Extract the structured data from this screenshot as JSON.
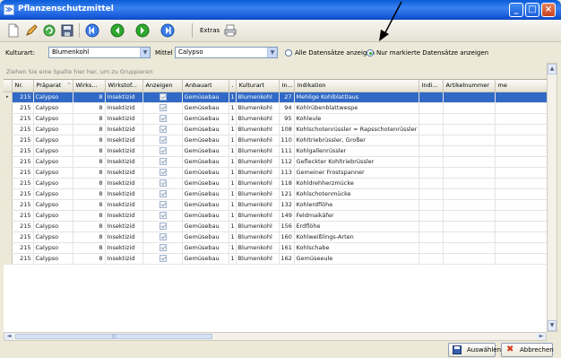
{
  "window": {
    "title": "Pflanzenschutzmittel"
  },
  "toolbar": {
    "extras_label": "Extras"
  },
  "filters": {
    "kulturart_label": "Kulturart:",
    "kulturart_value": "Blumenkohl",
    "mittel_label": "Mittel",
    "mittel_value": "Calypso",
    "radio_all_label": "Alle Datensätze anzeigen",
    "radio_marked_label": "Nur markierte Datensätze anzeigen",
    "selected_radio": "marked"
  },
  "grid": {
    "group_hint": "Ziehen Sie eine Spalte hier her, um zu Gruppieren",
    "columns": [
      "Nr.",
      "Präparat",
      "Wirks...",
      "Wirkstof...",
      "Anzeigen",
      "Anbauart",
      ".",
      "Kulturart",
      "In...",
      "Indikation",
      "Indi...",
      "Artikelnummer",
      "me"
    ],
    "sort_indicator": "^",
    "rows": [
      {
        "nr": "215",
        "praeparat": "Calypso",
        "wirks": "8",
        "wirkstof": "Insektizid",
        "anbauart": "Gemüsebau",
        "dot": "1",
        "kulturart": "Blumenkohl",
        "in": "27",
        "indikation": "Mehlige Kohlblattlaus",
        "selected": true
      },
      {
        "nr": "215",
        "praeparat": "Calypso",
        "wirks": "8",
        "wirkstof": "Insektizid",
        "anbauart": "Gemüsebau",
        "dot": "1",
        "kulturart": "Blumenkohl",
        "in": "94",
        "indikation": "Kohlrübenblattwespe"
      },
      {
        "nr": "215",
        "praeparat": "Calypso",
        "wirks": "8",
        "wirkstof": "Insektizid",
        "anbauart": "Gemüsebau",
        "dot": "1",
        "kulturart": "Blumenkohl",
        "in": "95",
        "indikation": "Kohleule"
      },
      {
        "nr": "215",
        "praeparat": "Calypso",
        "wirks": "8",
        "wirkstof": "Insektizid",
        "anbauart": "Gemüsebau",
        "dot": "1",
        "kulturart": "Blumenkohl",
        "in": "108",
        "indikation": "Kohlschotenrüssler = Rapsschotenrüssler"
      },
      {
        "nr": "215",
        "praeparat": "Calypso",
        "wirks": "8",
        "wirkstof": "Insektizid",
        "anbauart": "Gemüsebau",
        "dot": "1",
        "kulturart": "Blumenkohl",
        "in": "110",
        "indikation": "Kohltriebrüssler, Großer"
      },
      {
        "nr": "215",
        "praeparat": "Calypso",
        "wirks": "8",
        "wirkstof": "Insektizid",
        "anbauart": "Gemüsebau",
        "dot": "1",
        "kulturart": "Blumenkohl",
        "in": "111",
        "indikation": "Kohlgallenrüssler"
      },
      {
        "nr": "215",
        "praeparat": "Calypso",
        "wirks": "8",
        "wirkstof": "Insektizid",
        "anbauart": "Gemüsebau",
        "dot": "1",
        "kulturart": "Blumenkohl",
        "in": "112",
        "indikation": "Gefleckter Kohltriebrüssler"
      },
      {
        "nr": "215",
        "praeparat": "Calypso",
        "wirks": "8",
        "wirkstof": "Insektizid",
        "anbauart": "Gemüsebau",
        "dot": "1",
        "kulturart": "Blumenkohl",
        "in": "113",
        "indikation": "Gemeiner Frostspanner"
      },
      {
        "nr": "215",
        "praeparat": "Calypso",
        "wirks": "8",
        "wirkstof": "Insektizid",
        "anbauart": "Gemüsebau",
        "dot": "1",
        "kulturart": "Blumenkohl",
        "in": "118",
        "indikation": "Kohldrehherzmücke"
      },
      {
        "nr": "215",
        "praeparat": "Calypso",
        "wirks": "8",
        "wirkstof": "Insektizid",
        "anbauart": "Gemüsebau",
        "dot": "1",
        "kulturart": "Blumenkohl",
        "in": "121",
        "indikation": "Kohlschotenmücke"
      },
      {
        "nr": "215",
        "praeparat": "Calypso",
        "wirks": "8",
        "wirkstof": "Insektizid",
        "anbauart": "Gemüsebau",
        "dot": "1",
        "kulturart": "Blumenkohl",
        "in": "132",
        "indikation": "Kohlerdflöhe"
      },
      {
        "nr": "215",
        "praeparat": "Calypso",
        "wirks": "8",
        "wirkstof": "Insektizid",
        "anbauart": "Gemüsebau",
        "dot": "1",
        "kulturart": "Blumenkohl",
        "in": "149",
        "indikation": "Feldmaikäfer"
      },
      {
        "nr": "215",
        "praeparat": "Calypso",
        "wirks": "8",
        "wirkstof": "Insektizid",
        "anbauart": "Gemüsebau",
        "dot": "1",
        "kulturart": "Blumenkohl",
        "in": "156",
        "indikation": "Erdflöhe"
      },
      {
        "nr": "215",
        "praeparat": "Calypso",
        "wirks": "8",
        "wirkstof": "Insektizid",
        "anbauart": "Gemüsebau",
        "dot": "1",
        "kulturart": "Blumenkohl",
        "in": "160",
        "indikation": "Kohlweißlings-Arten"
      },
      {
        "nr": "215",
        "praeparat": "Calypso",
        "wirks": "8",
        "wirkstof": "Insektizid",
        "anbauart": "Gemüsebau",
        "dot": "1",
        "kulturart": "Blumenkohl",
        "in": "161",
        "indikation": "Kohlschabe"
      },
      {
        "nr": "215",
        "praeparat": "Calypso",
        "wirks": "8",
        "wirkstof": "Insektizid",
        "anbauart": "Gemüsebau",
        "dot": "1",
        "kulturart": "Blumenkohl",
        "in": "162",
        "indikation": "Gemüseeule"
      }
    ]
  },
  "buttons": {
    "select_label": "Auswählen",
    "cancel_label": "Abbrechen"
  },
  "colors": {
    "titlebar": "#1356d6",
    "selection": "#3169c6",
    "window_bg": "#ece9d8"
  }
}
